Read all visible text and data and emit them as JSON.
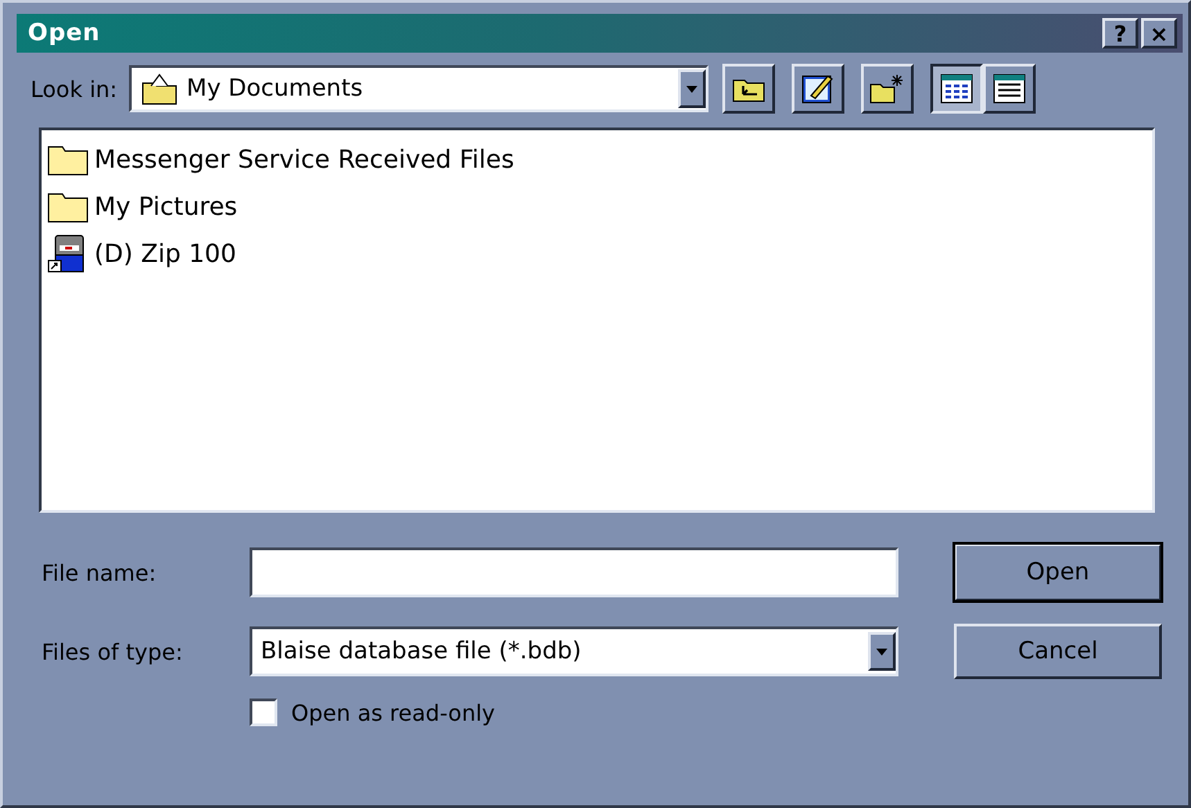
{
  "window": {
    "title": "Open",
    "title_buttons": [
      "?",
      "×"
    ]
  },
  "look_in": {
    "label": "Look in:",
    "value": "My Documents"
  },
  "toolbar": [
    {
      "kind": "up",
      "selected": false
    },
    {
      "kind": "desktop",
      "selected": false
    },
    {
      "kind": "new-folder",
      "selected": false
    },
    {
      "kind": "list",
      "selected": true
    },
    {
      "kind": "details",
      "selected": false
    }
  ],
  "files": [
    {
      "kind": "folder",
      "name": "Messenger Service Received Files"
    },
    {
      "kind": "folder",
      "name": "My Pictures"
    },
    {
      "kind": "drive",
      "name": "(D) Zip 100"
    }
  ],
  "file_name": {
    "label": "File name:"
  },
  "file_type": {
    "label": "Files of type:",
    "value": "Blaise database file (*.bdb)"
  },
  "read_only": {
    "label": "Open as read-only",
    "checked": false
  },
  "buttons": [
    {
      "label": "Open",
      "default": true
    },
    {
      "label": "Cancel",
      "default": false
    }
  ]
}
